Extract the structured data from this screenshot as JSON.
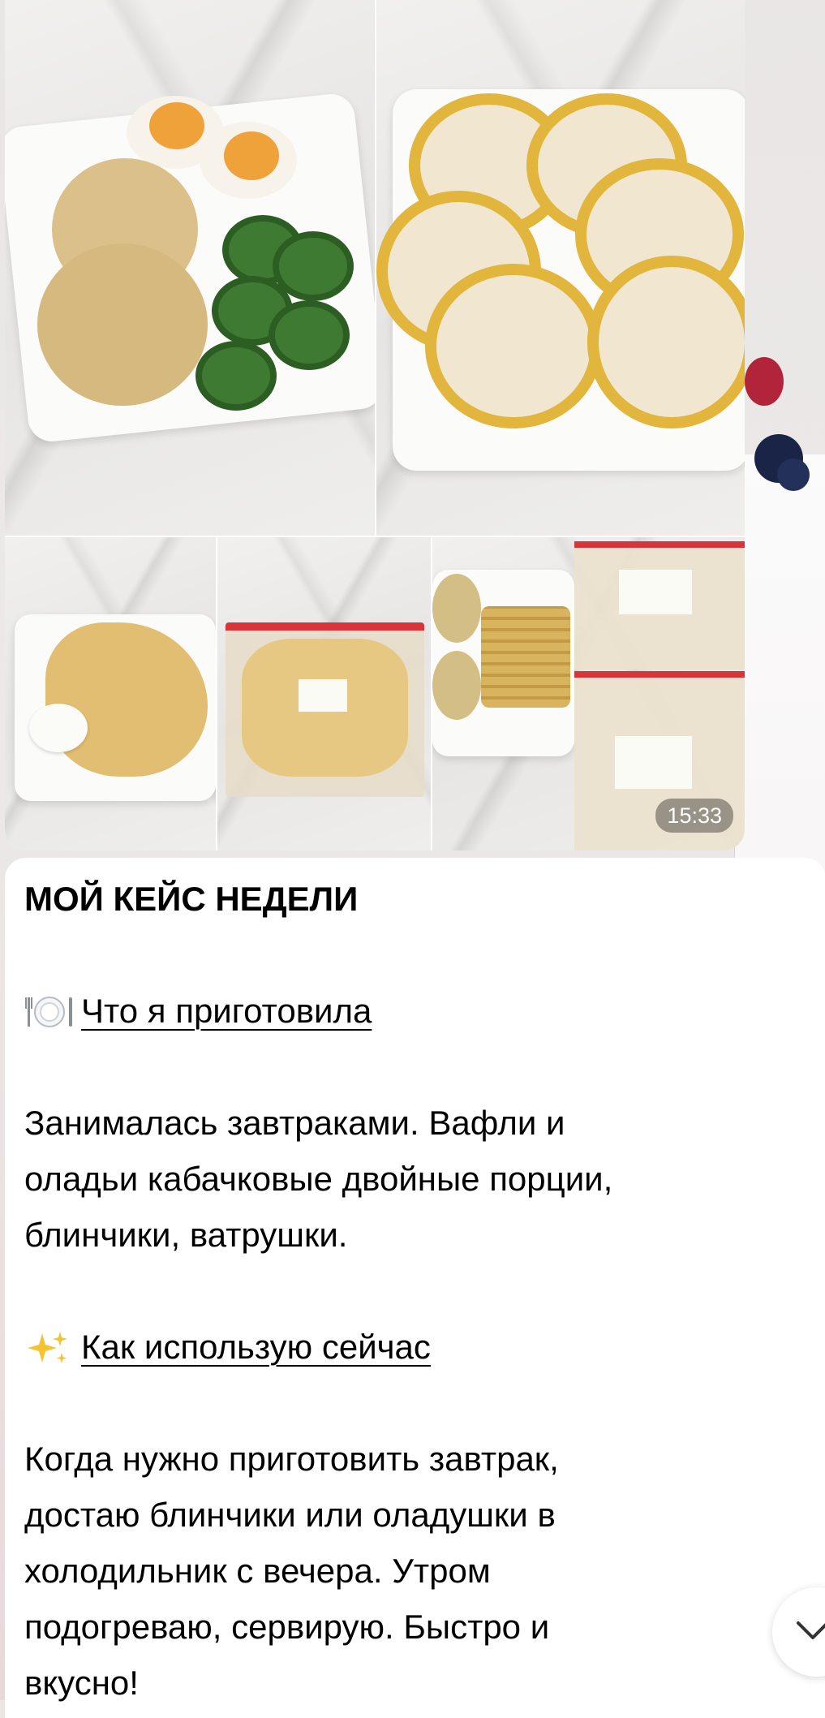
{
  "album": {
    "timestamp": "15:33",
    "photos": [
      "photo-cutlets-eggs-cucumbers",
      "photo-cheesecakes-apple",
      "photo-pancakes-sour-cream",
      "photo-pancakes-freezer-bag",
      "photo-waffles-fritters-bags"
    ]
  },
  "message": {
    "title": "МОЙ КЕЙС НЕДЕЛИ",
    "section1": {
      "icon": "plate-cutlery-icon",
      "heading": "Что я приготовила"
    },
    "paragraph1": {
      "line1": "Занималась завтраками. Вафли и",
      "line2": "оладьи кабачковые двойные порции,",
      "line3": "блинчики, ватрушки."
    },
    "section2": {
      "icon": "sparkles-icon",
      "heading": "Как использую сейчас"
    },
    "paragraph2": {
      "line1": "Когда нужно приготовить завтрак,",
      "line2": "достаю блинчики или оладушки в",
      "line3": "холодильник с вечера. Утром",
      "line4": "подогреваю, сервирую. Быстро и",
      "line5": "вкусно!"
    }
  },
  "controls": {
    "scroll_down_icon": "chevron-down-icon"
  }
}
